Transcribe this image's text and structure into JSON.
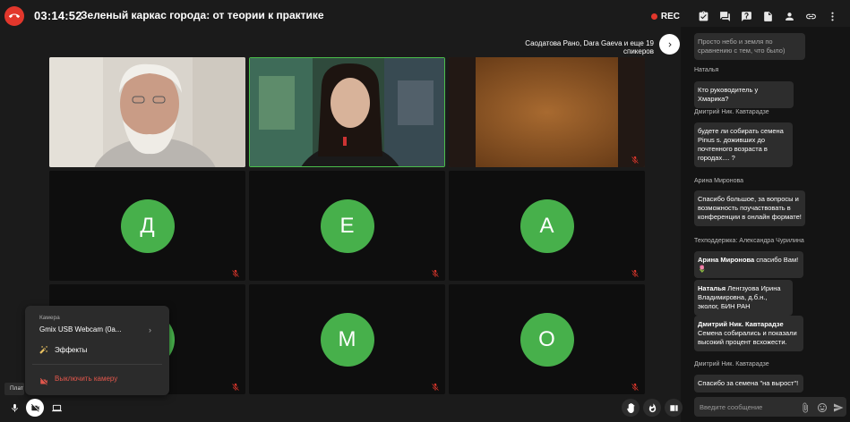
{
  "header": {
    "timer": "03:14:52",
    "title": "Зеленый каркас города: от теории к практике",
    "rec_label": "REC"
  },
  "speakers_text": "Саодатова Рано, Dara Gaeva и еще 19 спикеров",
  "tiles": [
    {
      "type": "video",
      "name": "participant-video-1"
    },
    {
      "type": "video",
      "name": "participant-video-2",
      "active": true
    },
    {
      "type": "video",
      "name": "participant-video-3",
      "muted": true
    },
    {
      "type": "avatar",
      "letter": "Д",
      "muted": true
    },
    {
      "type": "avatar",
      "letter": "Е",
      "muted": true
    },
    {
      "type": "avatar",
      "letter": "А",
      "muted": true
    },
    {
      "type": "avatar",
      "letter": "",
      "muted": true
    },
    {
      "type": "avatar",
      "letter": "М",
      "muted": true
    },
    {
      "type": "avatar",
      "letter": "О",
      "muted": true
    }
  ],
  "chat": {
    "messages": [
      {
        "text": "Просто небо и земля по сравнению с тем, что было)"
      },
      {
        "author": "Наталья",
        "text": "Кто руководитель у Хмарика?"
      },
      {
        "author": "Дмитрий Ник. Кавтарадзе",
        "text": "будете ли собирать семена Pinus s. доживших до почтенного возраста в городах.... ?"
      },
      {
        "author": "Арина Миронова",
        "text": "Спасибо большое, за вопросы и возможность поучаствовать в конференции в онлайн формате!"
      },
      {
        "author": "Техподдержка: Александра Чурилина"
      },
      {
        "bold": "Арина Миронова",
        "text": " спасибо Вам! 🌷"
      },
      {
        "bold": "Наталья",
        "text": " Ленгзуова Ирина Владимировна, д.б.н., эколог, БИН РАН"
      },
      {
        "bold": "Дмитрий Ник. Кавтарадзе",
        "text": "Семена собирались и показали высокий процент всхожести."
      },
      {
        "author": "Дмитрий Ник. Кавтарадзе",
        "text": "Спасибо за семена \"на вырост\"!"
      }
    ],
    "input_placeholder": "Введите сообщение"
  },
  "camera_popup": {
    "label": "Камера",
    "device": "Gmix USB Webcam (0a...",
    "effects": "Эффекты",
    "turn_off": "Выключить камеру"
  },
  "tooltip": "Плат",
  "colors": {
    "accent_green": "#47b04b",
    "danger_red": "#e2372c",
    "active_border": "#4bbf4b"
  }
}
